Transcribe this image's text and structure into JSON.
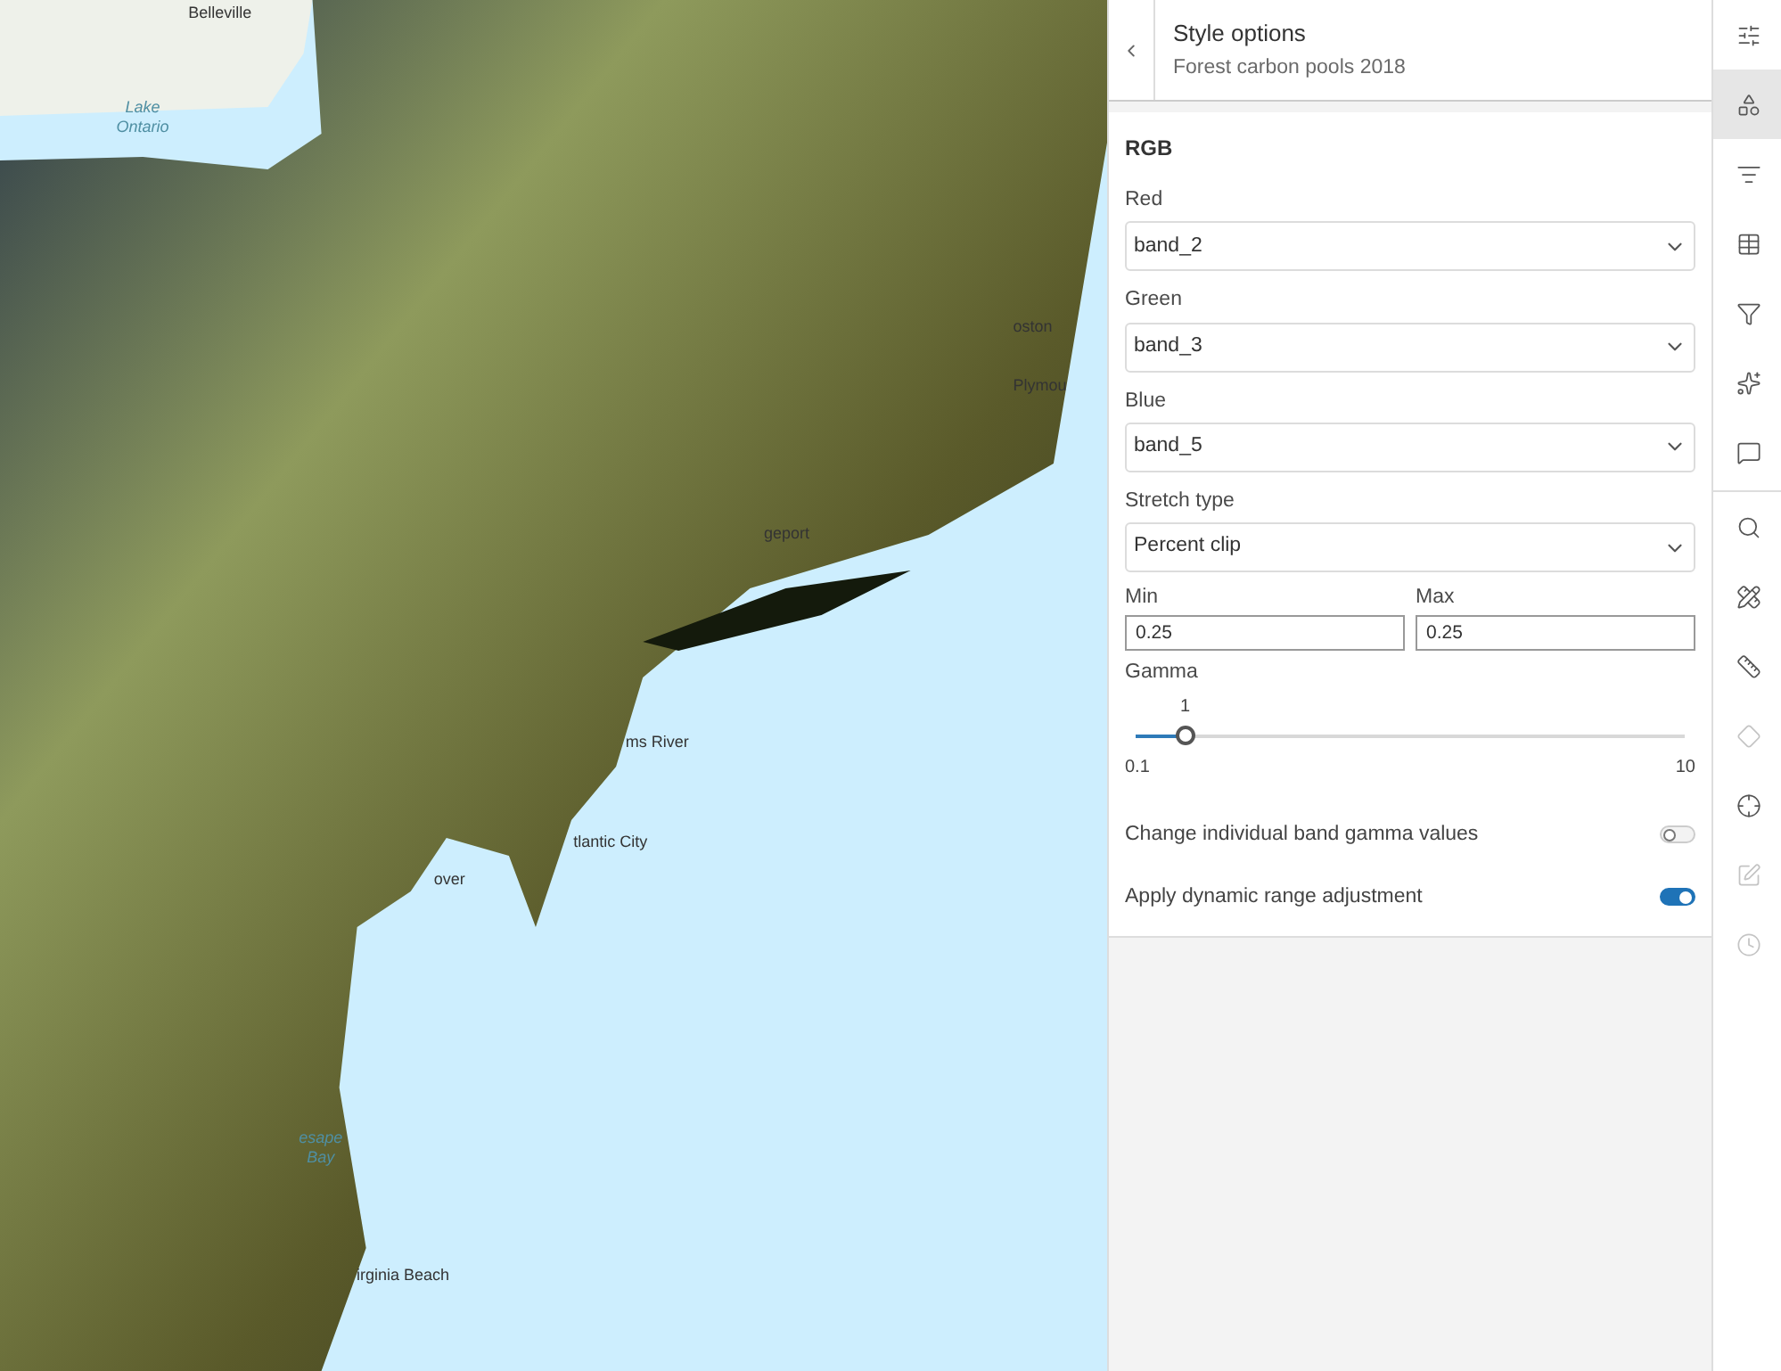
{
  "map": {
    "labels": [
      {
        "text": "Belleville",
        "kind": "city"
      },
      {
        "text": "Lake\nOntario",
        "kind": "water"
      },
      {
        "text": "oston",
        "kind": "city"
      },
      {
        "text": "Plymou",
        "kind": "city"
      },
      {
        "text": "geport",
        "kind": "city"
      },
      {
        "text": "ms River",
        "kind": "city"
      },
      {
        "text": "tlantic City",
        "kind": "city"
      },
      {
        "text": "over",
        "kind": "city"
      },
      {
        "text": "esape\nBay",
        "kind": "water"
      },
      {
        "text": "irginia Beach",
        "kind": "city"
      }
    ]
  },
  "panel": {
    "title": "Style options",
    "subtitle": "Forest carbon pools 2018",
    "section": "RGB",
    "bands": [
      {
        "label": "Red",
        "value": "band_2"
      },
      {
        "label": "Green",
        "value": "band_3"
      },
      {
        "label": "Blue",
        "value": "band_5"
      }
    ],
    "stretch": {
      "label": "Stretch type",
      "value": "Percent clip"
    },
    "range": [
      {
        "label": "Min",
        "value": "0.25"
      },
      {
        "label": "Max",
        "value": "0.25"
      }
    ],
    "gamma": {
      "label": "Gamma",
      "value": "1",
      "min": "0.1",
      "max": "10",
      "level": 0.09
    },
    "toggles": [
      {
        "label": "Change individual band gamma values",
        "on": false
      },
      {
        "label": "Apply dynamic range adjustment",
        "on": true
      }
    ]
  },
  "toolbar": [
    {
      "selected": false,
      "disabled": false
    },
    {
      "selected": true,
      "disabled": false
    },
    {
      "selected": false,
      "disabled": false
    },
    {
      "selected": false,
      "disabled": false
    },
    {
      "selected": false,
      "disabled": false
    },
    {
      "selected": false,
      "disabled": false
    },
    {
      "selected": false,
      "disabled": false
    },
    {
      "selected": false,
      "disabled": false
    },
    {
      "selected": false,
      "disabled": false
    },
    {
      "selected": false,
      "disabled": false
    },
    {
      "selected": false,
      "disabled": true
    },
    {
      "selected": false,
      "disabled": false
    },
    {
      "selected": false,
      "disabled": true
    },
    {
      "selected": false,
      "disabled": true
    }
  ]
}
